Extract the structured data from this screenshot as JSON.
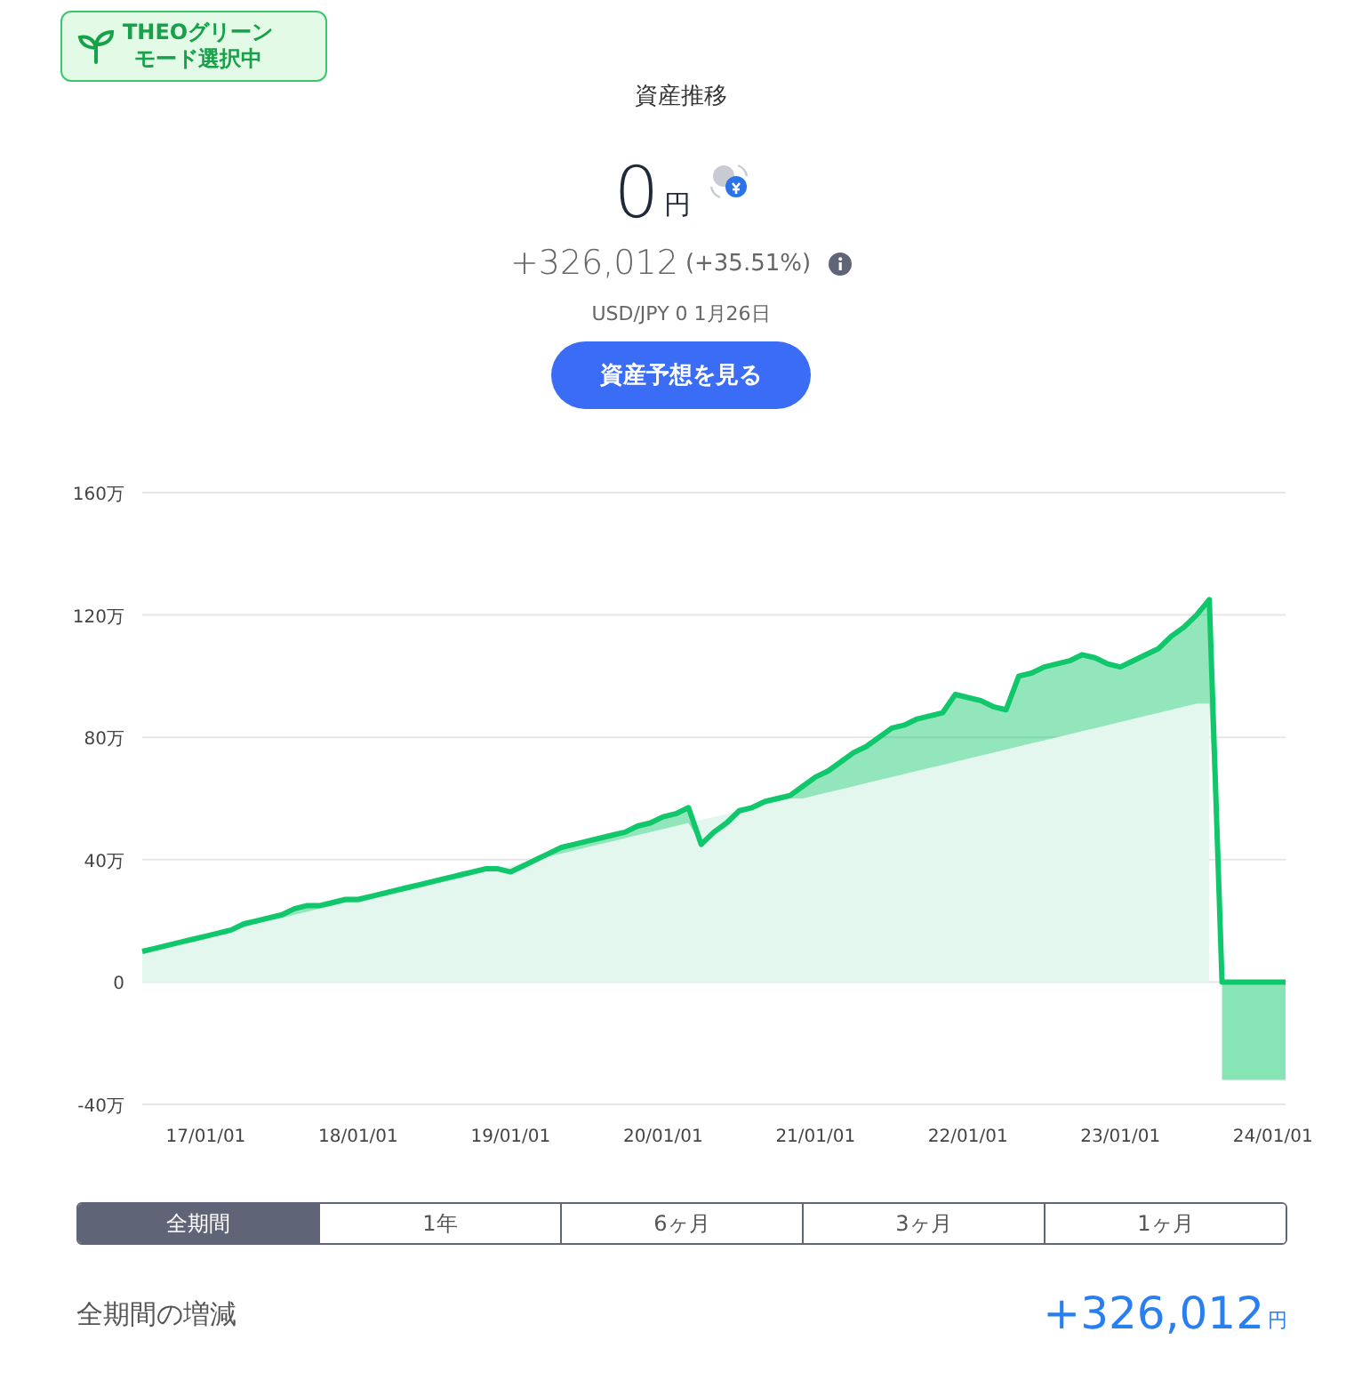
{
  "badge": {
    "lines": [
      "THEOグリーン",
      "モード選択中"
    ]
  },
  "title": "資産推移",
  "balance": {
    "amount": "0",
    "unit": "円"
  },
  "change": {
    "amount": "+326,012",
    "percent": "(+35.51%)"
  },
  "rate_note": "USD/JPY 0 1月26日",
  "forecast_button": "資産予想を見る",
  "chart": {
    "chart_data": {
      "type": "area",
      "categories": [
        null,
        null,
        null,
        null,
        null,
        "17/01/01",
        null,
        null,
        null,
        null,
        null,
        null,
        null,
        null,
        null,
        null,
        null,
        "18/01/01",
        null,
        null,
        null,
        null,
        null,
        null,
        null,
        null,
        null,
        null,
        null,
        "19/01/01",
        null,
        null,
        null,
        null,
        null,
        null,
        null,
        null,
        null,
        null,
        null,
        "20/01/01",
        null,
        null,
        null,
        null,
        null,
        null,
        null,
        null,
        null,
        null,
        null,
        "21/01/01",
        null,
        null,
        null,
        null,
        null,
        null,
        null,
        null,
        null,
        null,
        null,
        "22/01/01",
        null,
        null,
        null,
        null,
        null,
        null,
        null,
        null,
        null,
        null,
        null,
        "23/01/01",
        null,
        null,
        null,
        null,
        null,
        null,
        null,
        null,
        null,
        null,
        null,
        "24/01/01",
        null
      ],
      "series": [
        {
          "color": "#10c76b",
          "values": [
            10,
            11,
            12,
            13,
            14,
            15,
            16,
            17,
            19,
            20,
            21,
            22,
            24,
            25,
            25,
            26,
            27,
            27,
            28,
            29,
            30,
            31,
            32,
            33,
            34,
            35,
            36,
            37,
            37,
            36,
            38,
            40,
            42,
            44,
            45,
            46,
            47,
            48,
            49,
            51,
            52,
            54,
            55,
            57,
            45,
            49,
            52,
            56,
            57,
            59,
            60,
            61,
            64,
            67,
            69,
            72,
            75,
            77,
            80,
            83,
            84,
            86,
            87,
            88,
            94,
            93,
            92,
            90,
            89,
            100,
            101,
            103,
            104,
            105,
            107,
            106,
            104,
            103,
            105,
            107,
            109,
            113,
            116,
            120,
            125,
            0,
            0,
            0,
            0,
            0,
            0
          ]
        },
        {
          "color": "#e3f7ee",
          "values": [
            10,
            11,
            12,
            13,
            14,
            15,
            16,
            17,
            18,
            19,
            20,
            21,
            22,
            23,
            24,
            25,
            26,
            26,
            27,
            28,
            29,
            30,
            31,
            32,
            33,
            34,
            35,
            36,
            37,
            38,
            39,
            40,
            41,
            42,
            43,
            44,
            45,
            46,
            47,
            48,
            49,
            50,
            51,
            52,
            53,
            54,
            55,
            56,
            57,
            58,
            59,
            60,
            60,
            61,
            62,
            63,
            64,
            65,
            66,
            67,
            68,
            69,
            70,
            71,
            72,
            73,
            74,
            75,
            76,
            77,
            78,
            79,
            80,
            81,
            82,
            83,
            84,
            85,
            86,
            87,
            88,
            89,
            90,
            91,
            91,
            null,
            null,
            null,
            null,
            null,
            null
          ]
        },
        {
          "color": "#86e4b5",
          "values": [
            null,
            null,
            null,
            null,
            null,
            null,
            null,
            null,
            null,
            null,
            null,
            null,
            null,
            null,
            null,
            null,
            null,
            null,
            null,
            null,
            null,
            null,
            null,
            null,
            null,
            null,
            null,
            null,
            null,
            null,
            null,
            null,
            null,
            null,
            null,
            null,
            null,
            null,
            null,
            null,
            null,
            null,
            null,
            null,
            null,
            null,
            null,
            null,
            null,
            null,
            null,
            null,
            null,
            null,
            null,
            null,
            null,
            null,
            null,
            null,
            null,
            null,
            null,
            null,
            null,
            null,
            null,
            null,
            null,
            null,
            null,
            null,
            null,
            null,
            null,
            null,
            null,
            null,
            null,
            null,
            null,
            null,
            null,
            null,
            null,
            -32,
            -32,
            -32,
            -32,
            -32,
            -32
          ]
        }
      ],
      "ylim": [
        -40,
        160
      ],
      "grid": true,
      "yticks": [
        {
          "value": 160,
          "label": "160万"
        },
        {
          "value": 120,
          "label": "120万"
        },
        {
          "value": 80,
          "label": "80万"
        },
        {
          "value": 40,
          "label": "40万"
        },
        0,
        {
          "value": -40,
          "label": "-40万"
        }
      ]
    }
  },
  "periods": [
    {
      "label": "全期間",
      "selected": true
    },
    {
      "label": "1年",
      "selected": false
    },
    {
      "label": "6ヶ月",
      "selected": false
    },
    {
      "label": "3ヶ月",
      "selected": false
    },
    {
      "label": "1ヶ月",
      "selected": false
    }
  ],
  "summary": {
    "label": "全期間の増減",
    "amount": "+326,012",
    "unit": "円"
  }
}
